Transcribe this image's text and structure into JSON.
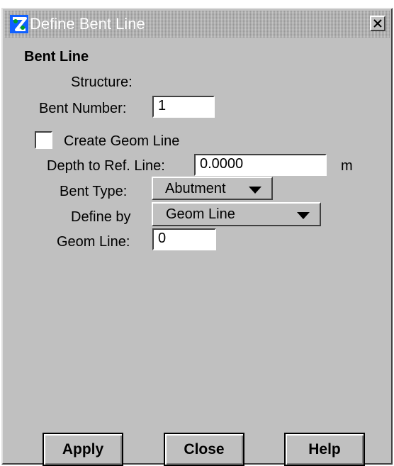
{
  "window": {
    "title": "Define Bent Line"
  },
  "group": {
    "title": "Bent Line"
  },
  "form": {
    "structure_label": "Structure:",
    "bent_number_label": "Bent Number:",
    "bent_number_value": "1",
    "create_geom_line_label": "Create Geom Line",
    "create_geom_line_checked": false,
    "depth_label": "Depth to Ref. Line:",
    "depth_value": "0.0000",
    "depth_unit": "m",
    "bent_type_label": "Bent Type:",
    "bent_type_value": "Abutment",
    "define_by_label": "Define by",
    "define_by_value": "Geom Line",
    "geom_line_label": "Geom Line:",
    "geom_line_value": "0"
  },
  "buttons": {
    "apply": "Apply",
    "close": "Close",
    "help": "Help"
  },
  "icons": {
    "app": "app-logo-icon",
    "close": "close-icon",
    "dropdown": "triangle-down-icon"
  },
  "colors": {
    "dialog_bg": "#c0c0c0",
    "title_bar": "#a8a8a8",
    "app_icon_blue": "#1060ff",
    "app_icon_green": "#00a020"
  }
}
